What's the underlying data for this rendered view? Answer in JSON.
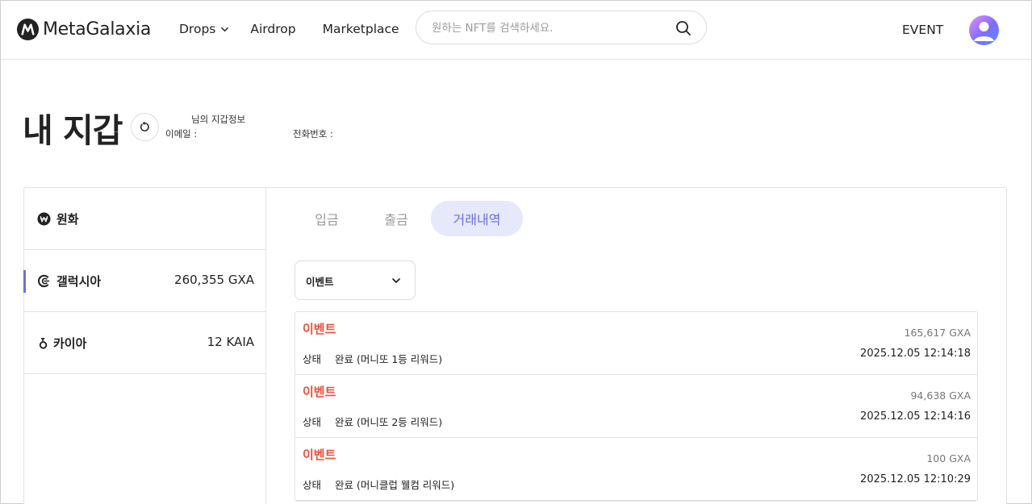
{
  "header": {
    "logo_text": "MetaGalaxia",
    "nav": [
      {
        "label": "Drops"
      },
      {
        "label": "Airdrop"
      },
      {
        "label": "Marketplace"
      }
    ],
    "search_placeholder": "원하는 NFT를 검색하세요.",
    "event_label": "EVENT"
  },
  "wallet": {
    "title": "내 지갑",
    "info_title": "님의 지갑정보",
    "email_label": "이메일 :",
    "phone_label": "전화번호 :"
  },
  "assets": [
    {
      "name": "원화",
      "amount": "",
      "icon": "won-icon"
    },
    {
      "name": "갤럭시아",
      "amount": "260,355 GXA",
      "icon": "galaxia-icon"
    },
    {
      "name": "카이아",
      "amount": "12 KAIA",
      "icon": "kaia-icon"
    }
  ],
  "tabs": [
    {
      "label": "입금"
    },
    {
      "label": "출금"
    },
    {
      "label": "거래내역"
    }
  ],
  "filter": {
    "selected": "이벤트"
  },
  "transactions": [
    {
      "type": "이벤트",
      "amount": "165,617 GXA",
      "status_label": "상태",
      "status": "완료 (머니또 1등 리워드)",
      "time": "2025.12.05 12:14:18"
    },
    {
      "type": "이벤트",
      "amount": "94,638 GXA",
      "status_label": "상태",
      "status": "완료 (머니또 2등 리워드)",
      "time": "2025.12.05 12:14:16"
    },
    {
      "type": "이벤트",
      "amount": "100 GXA",
      "status_label": "상태",
      "status": "완료 (머니클럽 웰컴 리워드)",
      "time": "2025.12.05 12:10:29"
    }
  ],
  "colors": {
    "accent": "#6b6fe0",
    "accent_bg": "#e6e8fb",
    "event_red": "#e8513a"
  }
}
